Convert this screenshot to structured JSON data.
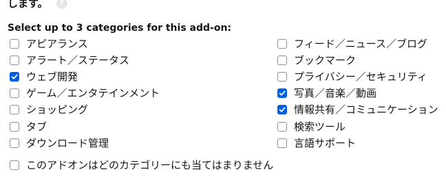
{
  "intro": {
    "text_fragment": "します。",
    "help_icon": "help-icon"
  },
  "categories": {
    "heading": "Select up to 3 categories for this add-on:",
    "left": [
      {
        "label": "アピアランス",
        "checked": false
      },
      {
        "label": "アラート／ステータス",
        "checked": false
      },
      {
        "label": "ウェブ開発",
        "checked": true
      },
      {
        "label": "ゲーム／エンタテインメント",
        "checked": false
      },
      {
        "label": "ショッピング",
        "checked": false
      },
      {
        "label": "タブ",
        "checked": false
      },
      {
        "label": "ダウンロード管理",
        "checked": false
      }
    ],
    "right": [
      {
        "label": "フィード／ニュース／ブログ",
        "checked": false
      },
      {
        "label": "ブックマーク",
        "checked": false
      },
      {
        "label": "プライバシー／セキュリティ",
        "checked": false
      },
      {
        "label": "写真／音楽／動画",
        "checked": true
      },
      {
        "label": "情報共有／コミュニケーション",
        "checked": true
      },
      {
        "label": "検索ツール",
        "checked": false
      },
      {
        "label": "言語サポート",
        "checked": false
      }
    ],
    "none_option": {
      "label": "このアドオンはどのカテゴリーにも当てはまりません",
      "checked": false
    }
  },
  "colors": {
    "checkbox_checked": "#0061e0",
    "checkbox_border": "#8f8f9d",
    "text": "#15141a"
  }
}
